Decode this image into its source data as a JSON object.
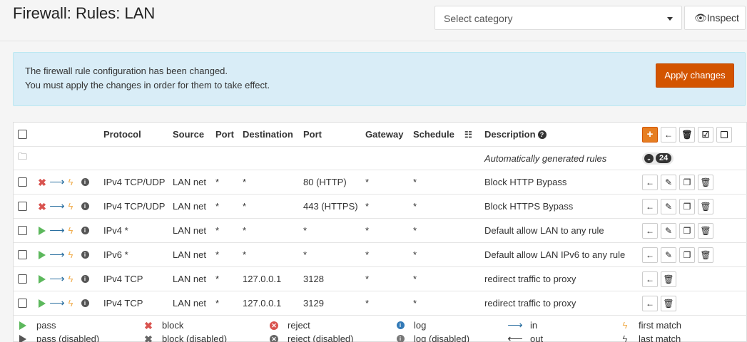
{
  "header": {
    "title": "Firewall: Rules: LAN",
    "category_select": "Select category",
    "inspect_label": "Inspect"
  },
  "alert": {
    "line1": "The firewall rule configuration has been changed.",
    "line2": "You must apply the changes in order for them to take effect.",
    "apply_label": "Apply changes"
  },
  "table": {
    "columns": [
      "Protocol",
      "Source",
      "Port",
      "Destination",
      "Port",
      "Gateway",
      "Schedule",
      "Description"
    ],
    "auto_rules_label": "Automatically generated rules",
    "auto_rules_count": "24",
    "rows": [
      {
        "action": "block",
        "protocol": "IPv4 TCP/UDP",
        "source": "LAN net",
        "sport": "*",
        "destination": "*",
        "dport": "80 (HTTP)",
        "gateway": "*",
        "schedule": "*",
        "description": "Block HTTP Bypass",
        "controls": [
          "move",
          "edit",
          "copy",
          "delete"
        ]
      },
      {
        "action": "block",
        "protocol": "IPv4 TCP/UDP",
        "source": "LAN net",
        "sport": "*",
        "destination": "*",
        "dport": "443 (HTTPS)",
        "gateway": "*",
        "schedule": "*",
        "description": "Block HTTPS Bypass",
        "controls": [
          "move",
          "edit",
          "copy",
          "delete"
        ]
      },
      {
        "action": "pass",
        "protocol": "IPv4 *",
        "source": "LAN net",
        "sport": "*",
        "destination": "*",
        "dport": "*",
        "gateway": "*",
        "schedule": "*",
        "description": "Default allow LAN to any rule",
        "controls": [
          "move",
          "edit",
          "copy",
          "delete"
        ]
      },
      {
        "action": "pass",
        "protocol": "IPv6 *",
        "source": "LAN net",
        "sport": "*",
        "destination": "*",
        "dport": "*",
        "gateway": "*",
        "schedule": "*",
        "description": "Default allow LAN IPv6 to any rule",
        "controls": [
          "move",
          "edit",
          "copy",
          "delete"
        ]
      },
      {
        "action": "pass",
        "protocol": "IPv4 TCP",
        "source": "LAN net",
        "sport": "*",
        "destination": "127.0.0.1",
        "dport": "3128",
        "gateway": "*",
        "schedule": "*",
        "description": "redirect traffic to proxy",
        "controls": [
          "move",
          "delete"
        ]
      },
      {
        "action": "pass",
        "protocol": "IPv4 TCP",
        "source": "LAN net",
        "sport": "*",
        "destination": "127.0.0.1",
        "dport": "3129",
        "gateway": "*",
        "schedule": "*",
        "description": "redirect traffic to proxy",
        "controls": [
          "move",
          "delete"
        ]
      }
    ]
  },
  "legend": {
    "pass": "pass",
    "pass_disabled": "pass (disabled)",
    "block": "block",
    "block_disabled": "block (disabled)",
    "reject": "reject",
    "reject_disabled": "reject (disabled)",
    "log": "log",
    "log_disabled": "log (disabled)",
    "in": "in",
    "out": "out",
    "first_match": "first match",
    "last_match": "last match"
  },
  "colors": {
    "accent": "#d35400",
    "pass": "#5cb85c",
    "block": "#d9534f",
    "alert_bg": "#d9edf7"
  }
}
